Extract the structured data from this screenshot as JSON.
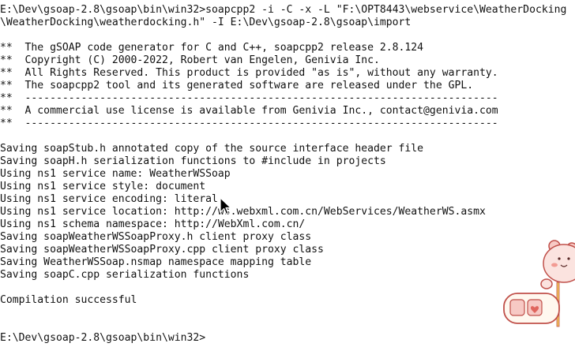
{
  "terminal": {
    "lines": [
      "E:\\Dev\\gsoap-2.8\\gsoap\\bin\\win32>soapcpp2 -i -C -x -L \"F:\\OPT8443\\webservice\\WeatherDocking",
      "\\WeatherDocking\\weatherdocking.h\" -I E:\\Dev\\gsoap-2.8\\gsoap\\import",
      "",
      "**  The gSOAP code generator for C and C++, soapcpp2 release 2.8.124",
      "**  Copyright (C) 2000-2022, Robert van Engelen, Genivia Inc.",
      "**  All Rights Reserved. This product is provided \"as is\", without any warranty.",
      "**  The soapcpp2 tool and its generated software are released under the GPL.",
      "**  ----------------------------------------------------------------------------",
      "**  A commercial use license is available from Genivia Inc., contact@genivia.com",
      "**  ----------------------------------------------------------------------------",
      "",
      "",
      "Saving soapStub.h annotated copy of the source interface header file",
      "Saving soapH.h serialization functions to #include in projects",
      "Using ns1 service name: WeatherWSSoap",
      "Using ns1 service style: document",
      "Using ns1 service encoding: literal",
      "Using ns1 service location: http://ws.webxml.com.cn/WebServices/WeatherWS.asmx",
      "Using ns1 schema namespace: http://WebXml.com.cn/",
      "Saving soapWeatherWSSoapProxy.h client proxy class",
      "Saving soapWeatherWSSoapProxy.cpp client proxy class",
      "Saving WeatherWSSoap.nsmap namespace mapping table",
      "Saving soapC.cpp serialization functions",
      "",
      "Compilation successful",
      "",
      "",
      "E:\\Dev\\gsoap-2.8\\gsoap\\bin\\win32>"
    ]
  },
  "colors": {
    "background": "#ffffff",
    "text": "#111111",
    "sticker_pink": "#f7c9c4",
    "sticker_outline": "#c0504a"
  },
  "icons": {
    "cursor": "mouse-pointer-icon",
    "sticker": "bear-sticker-icon"
  }
}
